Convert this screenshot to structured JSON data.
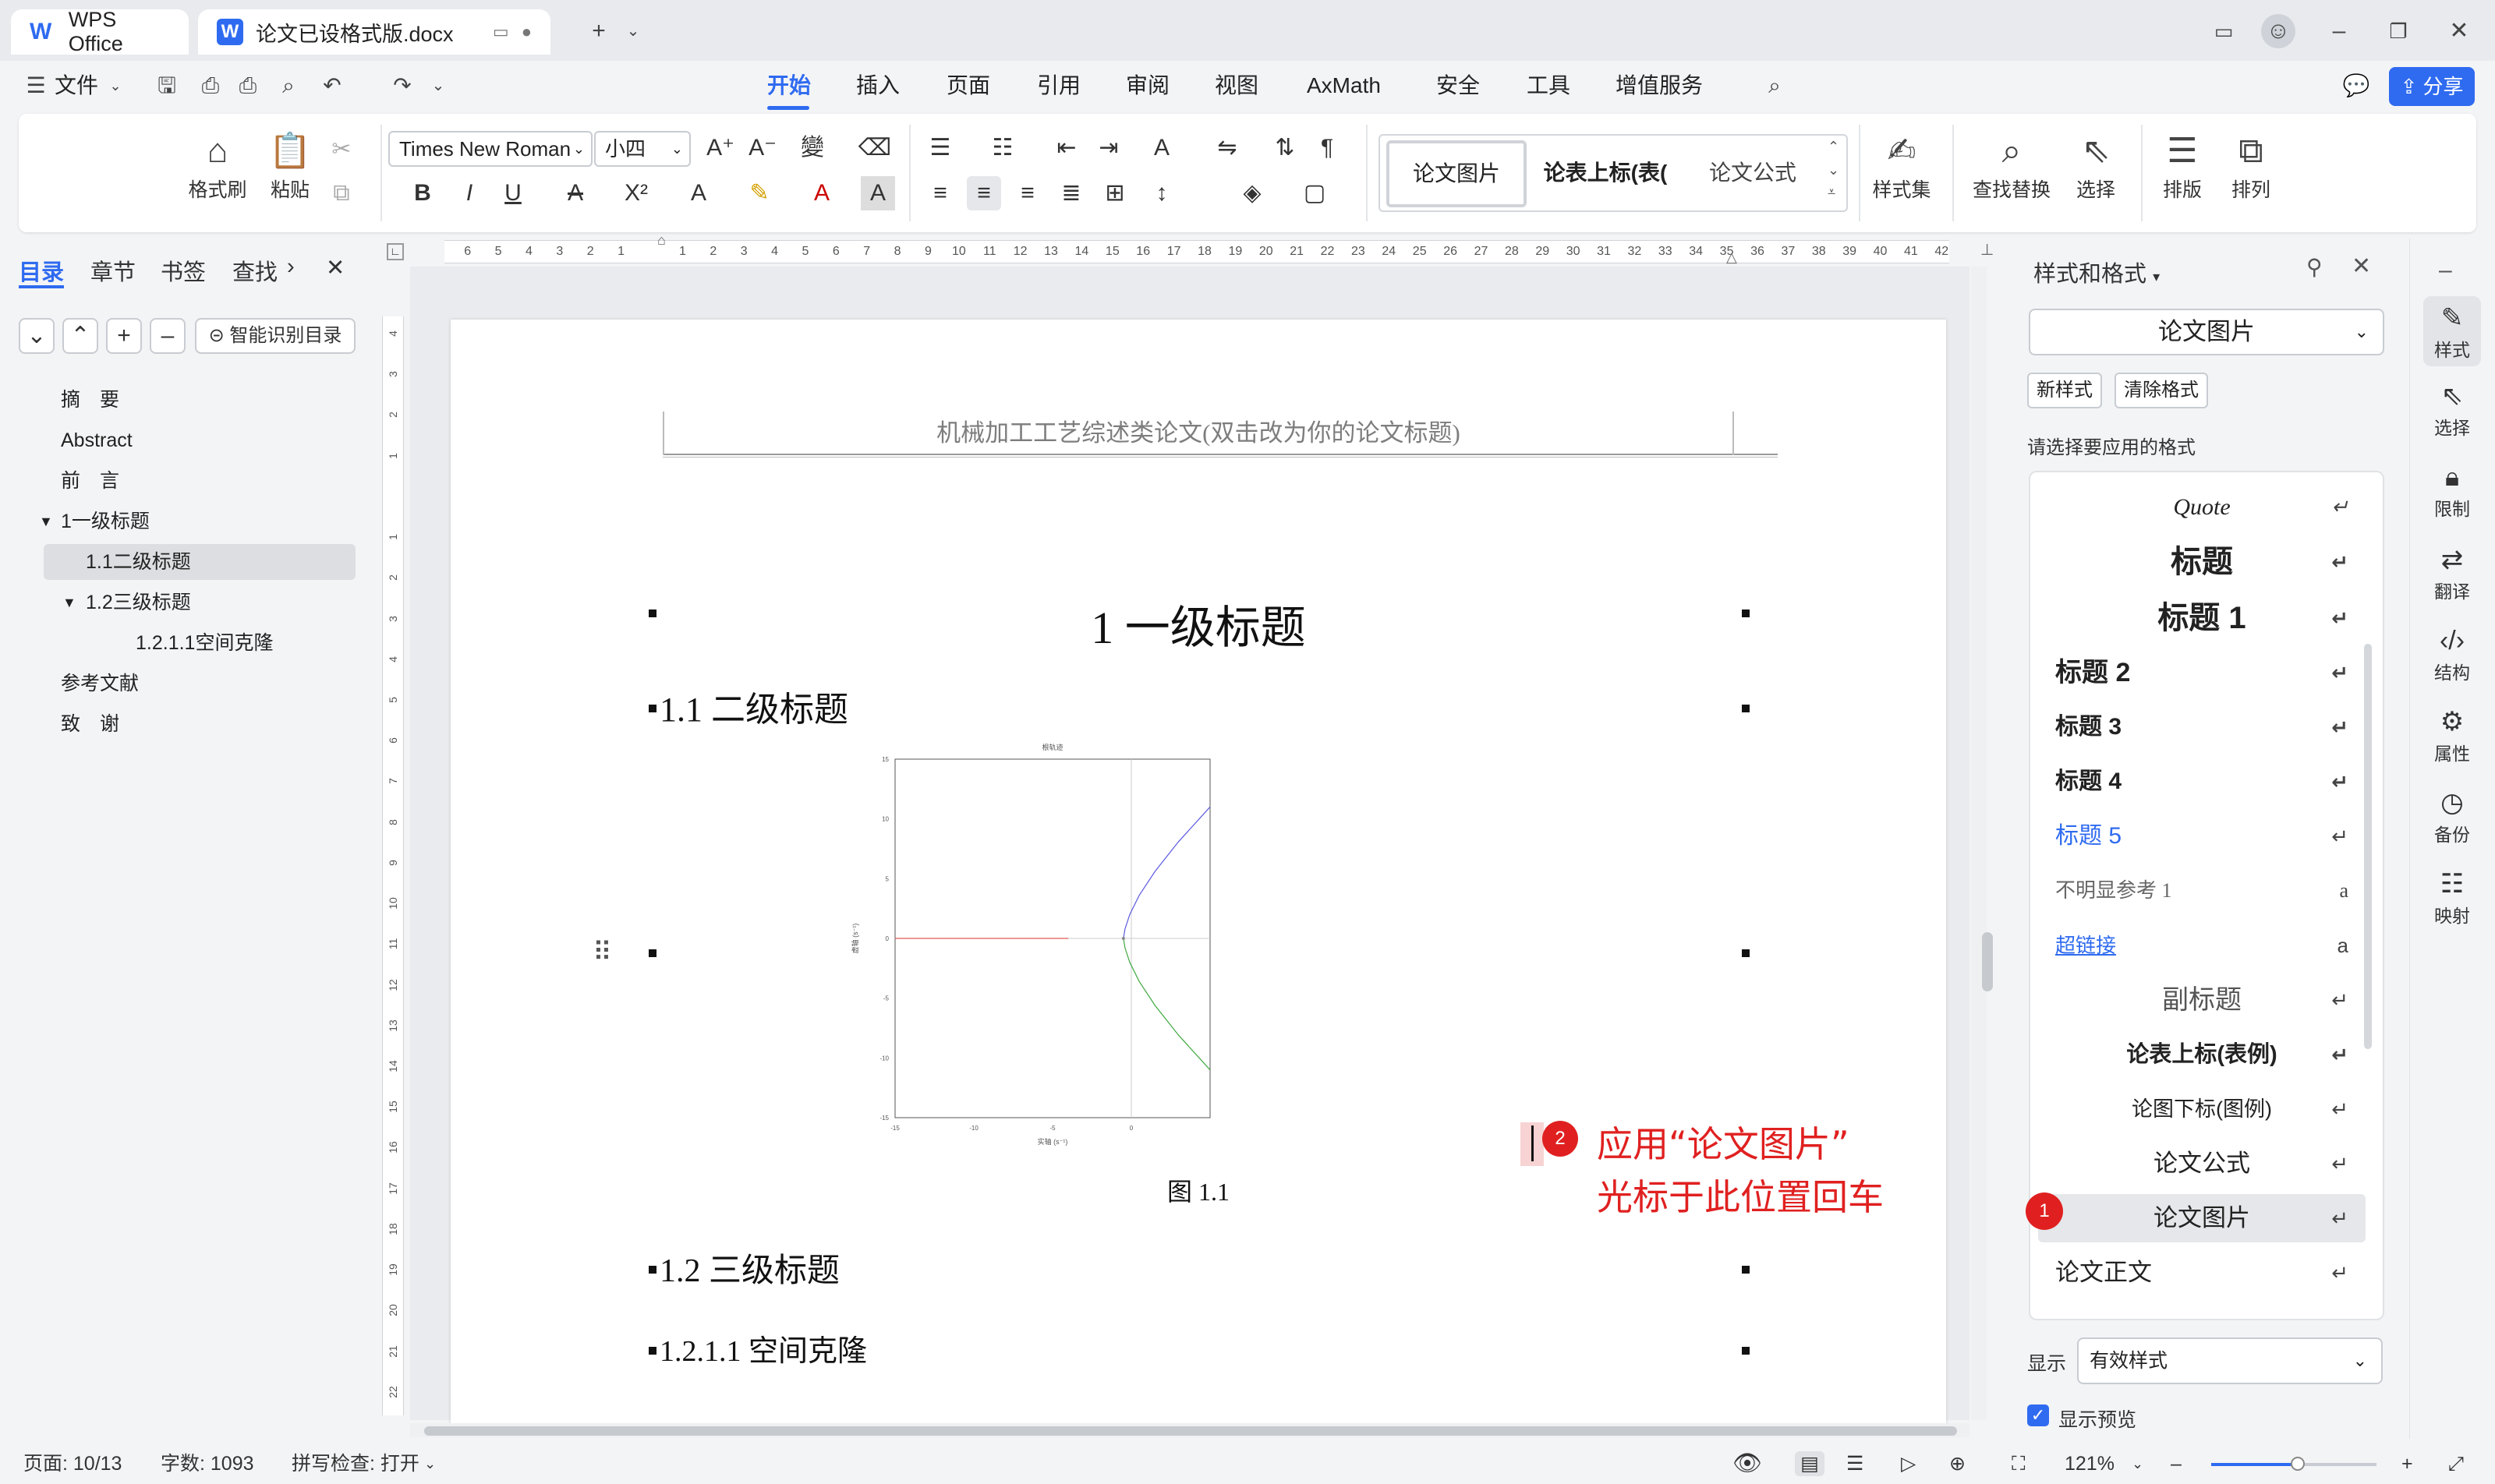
{
  "titlebar": {
    "app_tab": "WPS Office",
    "doc_tab": "论文已设格式版.docx"
  },
  "menu": {
    "file": "文件",
    "tabs": [
      "开始",
      "插入",
      "页面",
      "引用",
      "审阅",
      "视图",
      "AxMath",
      "安全",
      "工具",
      "增值服务"
    ],
    "active_tab": "开始",
    "share": "分享"
  },
  "ribbon": {
    "format_painter": "格式刷",
    "paste": "粘贴",
    "font_name": "Times New Roman",
    "font_size": "小四",
    "gallery": [
      "论文图片",
      "论表上标(表(",
      "论文公式"
    ],
    "style_set": "样式集",
    "find_replace": "查找替换",
    "select": "选择",
    "layout": "排版",
    "arrange": "排列"
  },
  "left_panel": {
    "tabs": [
      "目录",
      "章节",
      "书签",
      "查找"
    ],
    "active_tab": "目录",
    "smart_toc": "智能识别目录",
    "toc": [
      {
        "label": "摘　要",
        "level": 0
      },
      {
        "label": "Abstract",
        "level": 0
      },
      {
        "label": "前　言",
        "level": 0
      },
      {
        "label": "1一级标题",
        "level": 0,
        "expanded": true
      },
      {
        "label": "1.1二级标题",
        "level": 1,
        "selected": true
      },
      {
        "label": "1.2三级标题",
        "level": 1,
        "expanded": true
      },
      {
        "label": "1.2.1.1空间克隆",
        "level": 2
      },
      {
        "label": "参考文献",
        "level": 0
      },
      {
        "label": "致　谢",
        "level": 0
      }
    ]
  },
  "ruler": {
    "h_ticks": [
      "6",
      "5",
      "4",
      "3",
      "2",
      "1",
      "",
      "1",
      "2",
      "3",
      "4",
      "5",
      "6",
      "7",
      "8",
      "9",
      "10",
      "11",
      "12",
      "13",
      "14",
      "15",
      "16",
      "17",
      "18",
      "19",
      "20",
      "21",
      "22",
      "23",
      "24",
      "25",
      "26",
      "27",
      "28",
      "29",
      "30",
      "31",
      "32",
      "33",
      "34",
      "35",
      "36",
      "37",
      "38",
      "39",
      "40",
      "41",
      "42"
    ],
    "v_ticks": [
      "4",
      "3",
      "2",
      "1",
      "",
      "1",
      "2",
      "3",
      "4",
      "5",
      "6",
      "7",
      "8",
      "9",
      "10",
      "11",
      "12",
      "13",
      "14",
      "15",
      "16",
      "17",
      "18",
      "19",
      "20",
      "21",
      "22"
    ]
  },
  "document": {
    "header": "机械加工工艺综述类论文(双击改为你的论文标题)",
    "h1": "1 一级标题",
    "h2": "1.1 二级标题",
    "caption": "图 1.1",
    "h3": "1.2 三级标题",
    "h4": "1.2.1.1 空间克隆",
    "annotation_number": "2",
    "annotation_line1": "应用“论文图片”",
    "annotation_line2": "光标于此位置回车"
  },
  "chart_data": {
    "type": "line",
    "title": "根轨迹",
    "xlabel": "实轴 (s⁻¹)",
    "ylabel": "虚轴 (s⁻¹)",
    "xlim": [
      -15,
      5
    ],
    "ylim": [
      -15,
      15
    ],
    "xticks": [
      "-15",
      "-10",
      "-5",
      "0"
    ],
    "yticks": [
      "15",
      "10",
      "5",
      "0",
      "-5",
      "-10",
      "-15"
    ],
    "grid": false,
    "series": [
      {
        "color": "#e05a5a",
        "x": [
          -15,
          -4
        ],
        "y": [
          0,
          0
        ]
      },
      {
        "color": "#5a5ae0",
        "x": [
          -0.5,
          -0.4,
          -0.1,
          0.5,
          1.5,
          3,
          5
        ],
        "y": [
          0,
          0.8,
          2,
          3.6,
          5.6,
          8.1,
          11
        ]
      },
      {
        "color": "#3ea83e",
        "x": [
          -0.5,
          -0.4,
          -0.1,
          0.5,
          1.5,
          3,
          5
        ],
        "y": [
          0,
          -0.8,
          -2,
          -3.6,
          -5.6,
          -8.1,
          -11
        ]
      }
    ]
  },
  "right_panel": {
    "title": "样式和格式",
    "current_style": "论文图片",
    "new_style": "新样式",
    "clear_format": "清除格式",
    "prompt": "请选择要应用的格式",
    "styles": [
      "Quote",
      "标题",
      "标题 1",
      "标题 2",
      "标题 3",
      "标题 4",
      "标题 5",
      "不明显参考 1",
      "超链接",
      "副标题",
      "论表上标(表例)",
      "论图下标(图例)",
      "论文公式",
      "论文图片",
      "论文正文"
    ],
    "highlighted_style": "论文图片",
    "badge": "1",
    "show_label": "显示",
    "show_value": "有效样式",
    "show_preview": "显示预览"
  },
  "side_strip": [
    "样式",
    "选择",
    "限制",
    "翻译",
    "结构",
    "属性",
    "备份",
    "映射"
  ],
  "statusbar": {
    "page": "页面: 10/13",
    "words": "字数: 1093",
    "spell": "拼写检查: 打开",
    "zoom": "121%"
  },
  "colors": {
    "accent": "#2f6bf0",
    "annotation": "#e02020"
  }
}
